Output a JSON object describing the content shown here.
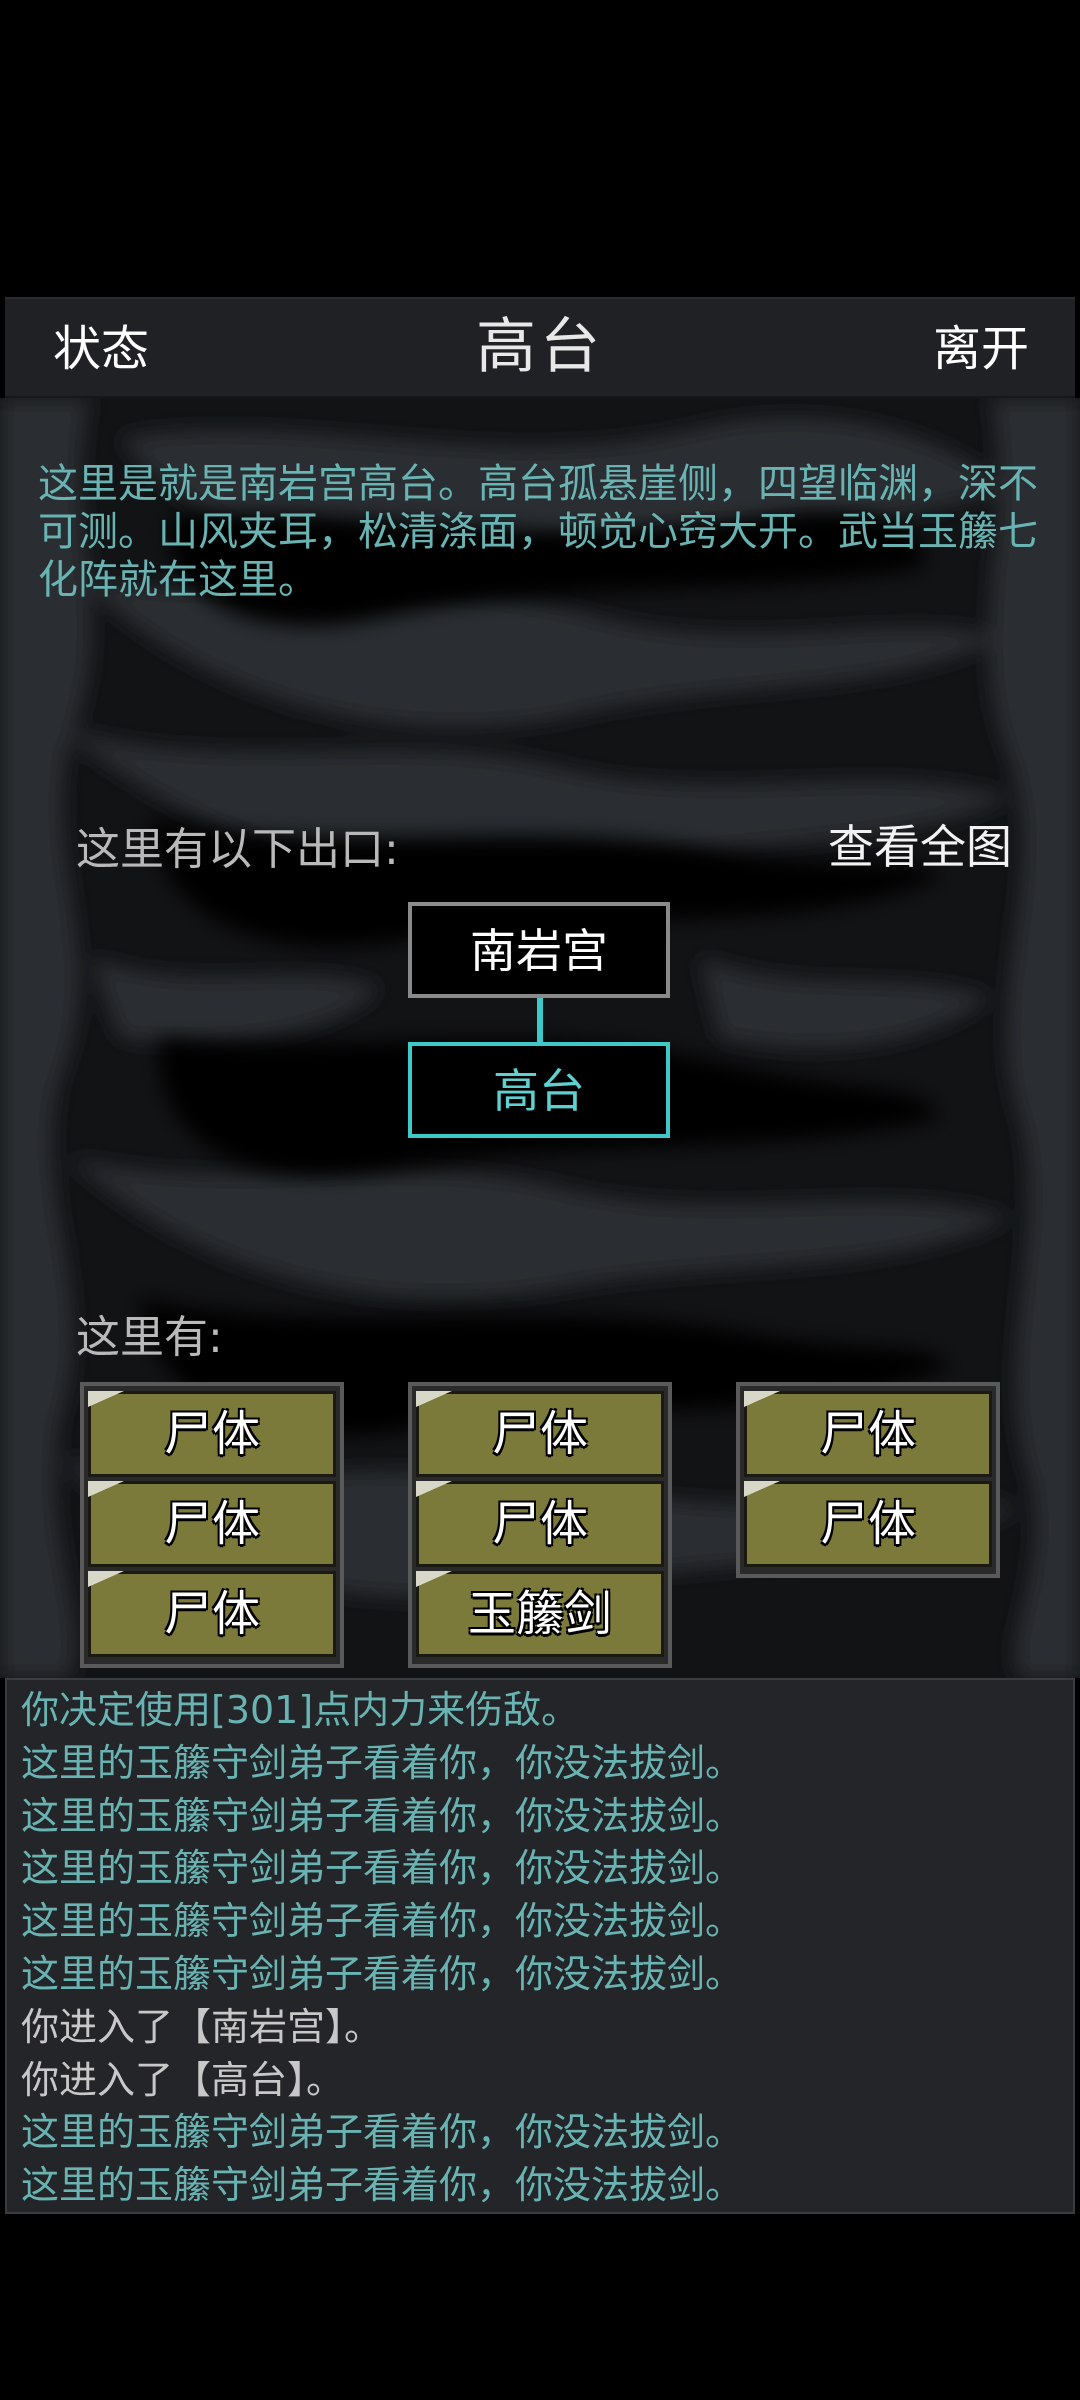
{
  "header": {
    "status_label": "状态",
    "title": "高台",
    "leave_label": "离开"
  },
  "room": {
    "description": "这里是就是南岩宫高台。高台孤悬崖侧，四望临渊，深不可测。山风夹耳，松清涤面，顿觉心窍大开。武当玉籘七化阵就在这里。"
  },
  "exits": {
    "label": "这里有以下出口:",
    "full_map_label": "查看全图",
    "north_room": "南岩宫",
    "current_room": "高台"
  },
  "items": {
    "label": "这里有:",
    "columns": [
      [
        "尸体",
        "尸体",
        "尸体"
      ],
      [
        "尸体",
        "尸体",
        "玉籘剑"
      ],
      [
        "尸体",
        "尸体"
      ]
    ]
  },
  "log": [
    "你决定使用[301]点内力来伤敌。",
    "这里的玉籘守剑弟子看着你，你没法拔剑。",
    "这里的玉籘守剑弟子看着你，你没法拔剑。",
    "这里的玉籘守剑弟子看着你，你没法拔剑。",
    "这里的玉籘守剑弟子看着你，你没法拔剑。",
    "这里的玉籘守剑弟子看着你，你没法拔剑。",
    "你进入了【南岩宫】。",
    "你进入了【高台】。",
    "这里的玉籘守剑弟子看着你，你没法拔剑。",
    "这里的玉籘守剑弟子看着你，你没法拔剑。"
  ],
  "colors": {
    "accent_cyan": "#3ec8c8",
    "text_cyan": "#69b3b3",
    "item_olive": "#7c7a3a"
  }
}
